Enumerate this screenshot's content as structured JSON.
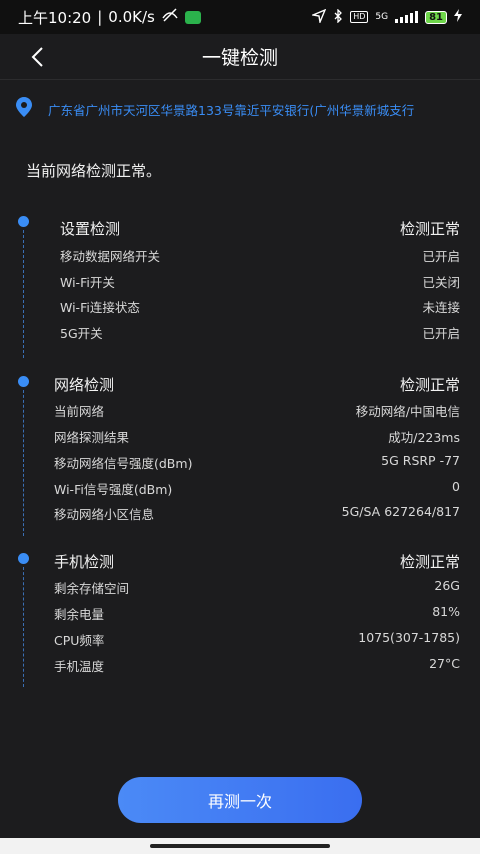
{
  "status_bar": {
    "time": "上午10:20",
    "network_speed": "0.0K/s",
    "hd": "HD",
    "network_type": "5G",
    "battery": "81"
  },
  "header": {
    "title": "一键检测"
  },
  "location": {
    "address": "广东省广州市天河区华景路133号靠近平安银行(广州华景新城支行"
  },
  "summary": "当前网络检测正常。",
  "sections": [
    {
      "title": "设置检测",
      "status": "检测正常",
      "rows": [
        {
          "label": "移动数据网络开关",
          "value": "已开启"
        },
        {
          "label": "Wi-Fi开关",
          "value": "已关闭"
        },
        {
          "label": "Wi-Fi连接状态",
          "value": "未连接"
        },
        {
          "label": "5G开关",
          "value": "已开启"
        }
      ]
    },
    {
      "title": "网络检测",
      "status": "检测正常",
      "rows": [
        {
          "label": "当前网络",
          "value": "移动网络/中国电信"
        },
        {
          "label": "网络探测结果",
          "value": "成功/223ms"
        },
        {
          "label": "移动网络信号强度(dBm)",
          "value": "5G RSRP -77"
        },
        {
          "label": "Wi-Fi信号强度(dBm)",
          "value": "0"
        },
        {
          "label": "移动网络小区信息",
          "value": "5G/SA 627264/817"
        }
      ]
    },
    {
      "title": "手机检测",
      "status": "检测正常",
      "rows": [
        {
          "label": "剩余存储空间",
          "value": "26G"
        },
        {
          "label": "剩余电量",
          "value": "81%"
        },
        {
          "label": "CPU频率",
          "value": "1075(307-1785)"
        },
        {
          "label": "手机温度",
          "value": "27°C"
        }
      ]
    }
  ],
  "retest_button": {
    "label": "再测一次"
  },
  "colors": {
    "accent": "#3a8df5",
    "background": "#1c1c1e",
    "button": "#4b7ff5"
  }
}
